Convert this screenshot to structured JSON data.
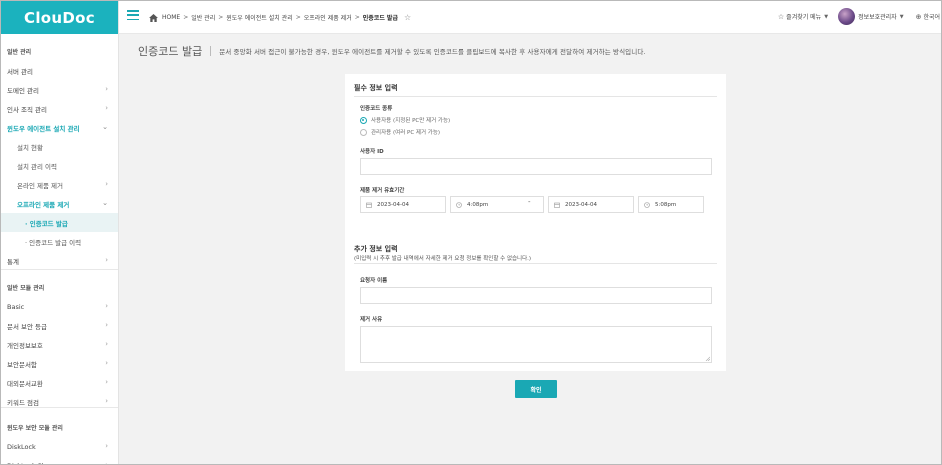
{
  "brand": {
    "logo": "ClouDoc",
    "accent": "#1aa8b4"
  },
  "sidebar": {
    "items": [
      {
        "label": "일반 관리",
        "type": "section"
      },
      {
        "label": "서버 관리",
        "type": "item"
      },
      {
        "label": "도메인 관리",
        "type": "item",
        "chevron": "›"
      },
      {
        "label": "인사 조직 관리",
        "type": "item",
        "chevron": "›"
      },
      {
        "label": "윈도우 에이전트 설치 관리",
        "type": "active",
        "chevron": "⌄"
      },
      {
        "label": "설치 현황",
        "type": "sub"
      },
      {
        "label": "설치 관리 이력",
        "type": "sub"
      },
      {
        "label": "온라인 제품 제거",
        "type": "sub",
        "chevron": "›"
      },
      {
        "label": "오프라인 제품 제거",
        "type": "sub-active",
        "chevron": "⌄"
      },
      {
        "label": "· 인증코드 발급",
        "type": "subsub-selected"
      },
      {
        "label": "· 인증코드 발급 이력",
        "type": "subsub"
      },
      {
        "label": "통계",
        "type": "item",
        "chevron": "›"
      },
      {
        "label": "일반 모듈 관리",
        "type": "section"
      },
      {
        "label": "Basic",
        "type": "item",
        "chevron": "›"
      },
      {
        "label": "문서 보안 등급",
        "type": "item",
        "chevron": "›"
      },
      {
        "label": "개인정보보호",
        "type": "item",
        "chevron": "›"
      },
      {
        "label": "보안문서함",
        "type": "item",
        "chevron": "›"
      },
      {
        "label": "대외문서교환",
        "type": "item",
        "chevron": "›"
      },
      {
        "label": "키워드 점검",
        "type": "item",
        "chevron": "›"
      },
      {
        "label": "윈도우 보안 모듈 관리",
        "type": "section"
      },
      {
        "label": "DiskLock",
        "type": "item",
        "chevron": "›"
      },
      {
        "label": "DiskLock Plus",
        "type": "item",
        "chevron": "›"
      }
    ]
  },
  "topbar": {
    "breadcrumb": [
      "HOME",
      "일반 관리",
      "윈도우 에이전트 설치 관리",
      "오프라인 제품 제거",
      "인증코드 발급"
    ],
    "separator": ">",
    "favorites_label": "즐겨찾기 메뉴",
    "user_name": "정보보호관리자",
    "language": "한국어"
  },
  "page": {
    "title": "인증코드 발급",
    "description": "문서 중앙화 서버 접근이 불가능한 경우, 윈도우 에이전트를 제거할 수 있도록 인증코드를 클립보드에 복사한 후 사용자에게 전달하여 제거하는 방식입니다."
  },
  "required_section": {
    "title": "필수 정보 입력",
    "code_type_label": "인증코드 종류",
    "options": [
      {
        "label": "사용자용 (지정된 PC만 제거 가능)",
        "selected": true
      },
      {
        "label": "관리자용 (여러 PC 제거 가능)",
        "selected": false
      }
    ],
    "user_id_label": "사용자 ID",
    "user_id_value": "",
    "period_label": "제품 제거 유효기간",
    "start_date": "2023-04-04",
    "start_time": "4:08pm",
    "range_separator": "-",
    "end_date": "2023-04-04",
    "end_time": "5:08pm"
  },
  "extra_section": {
    "title": "추가 정보 입력",
    "note": "(미입력 시 추후 발급 내역에서 자세한 제거 요청 정보를 확인할 수 없습니다.)",
    "requester_label": "요청자 이름",
    "requester_value": "",
    "reason_label": "제거 사유",
    "reason_value": ""
  },
  "confirm_label": "확인"
}
